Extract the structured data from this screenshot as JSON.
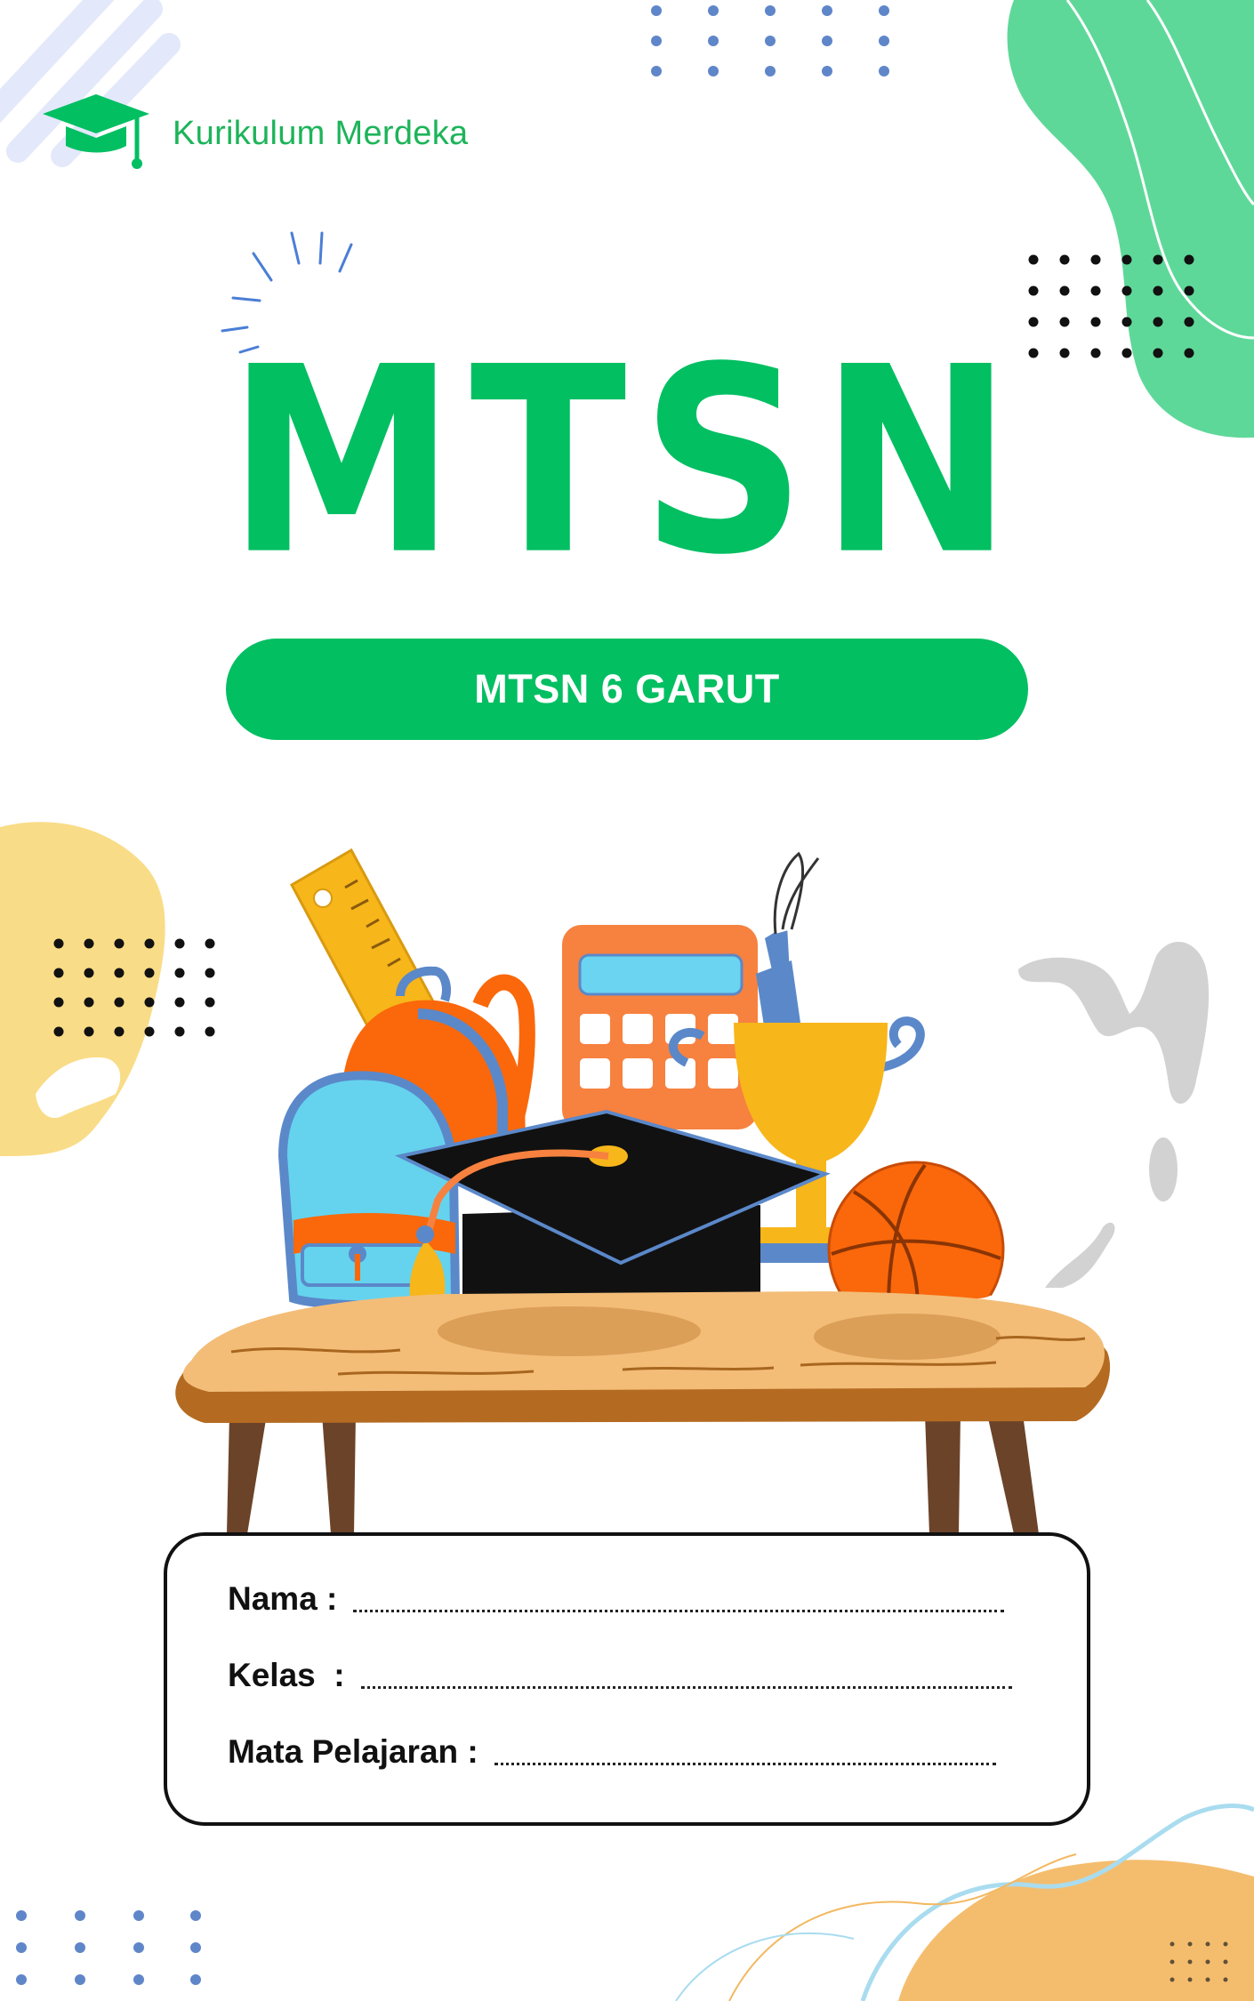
{
  "header": {
    "brand_label": "Kurikulum Merdeka",
    "brand_icon": "graduation-cap-icon"
  },
  "title": "MTSN",
  "school_badge": "MTSN 6 GARUT",
  "form": {
    "fields": [
      {
        "label": "Nama :",
        "value": ""
      },
      {
        "label": "Kelas  :",
        "value": ""
      },
      {
        "label": "Mata Pelajaran :",
        "value": ""
      }
    ]
  },
  "colors": {
    "brand_green": "#02bf62",
    "mint_blob": "#5ed899",
    "yellow_blob": "#f9dc87",
    "orange_blob": "#f4bd6e",
    "grey_splash": "#d2d2d2",
    "dot_blue": "#5f86c9"
  }
}
